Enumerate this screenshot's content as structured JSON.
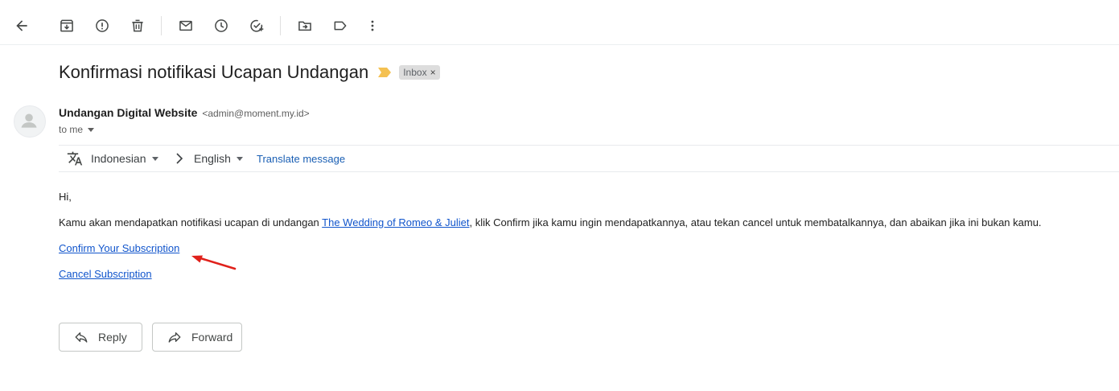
{
  "toolbar": {
    "icons": [
      "back-arrow-icon",
      "archive-icon",
      "report-spam-icon",
      "delete-icon",
      "mark-unread-icon",
      "snooze-icon",
      "add-task-icon",
      "move-to-icon",
      "label-icon",
      "more-vert-icon"
    ]
  },
  "email": {
    "subject": "Konfirmasi notifikasi Ucapan Undangan",
    "label": "Inbox",
    "label_close": "×",
    "importance_color": "#f4c152",
    "sender_name": "Undangan Digital Website",
    "sender_email": "<admin@moment.my.id>",
    "to_line": "to me"
  },
  "translate": {
    "source_lang": "Indonesian",
    "target_lang": "English",
    "action": "Translate message"
  },
  "body": {
    "greeting": "Hi,",
    "para_before_link": "Kamu akan mendapatkan notifikasi ucapan di undangan ",
    "para_link": "The Wedding of Romeo & Juliet",
    "para_after_link": ", klik Confirm jika kamu ingin mendapatkannya, atau tekan cancel untuk membatalkannya, dan abaikan jika ini bukan kamu.",
    "confirm_link": "Confirm Your Subscription",
    "cancel_link": "Cancel Subscription",
    "annotation_color": "#e0211b"
  },
  "actions": {
    "reply": "Reply",
    "forward": "Forward"
  }
}
